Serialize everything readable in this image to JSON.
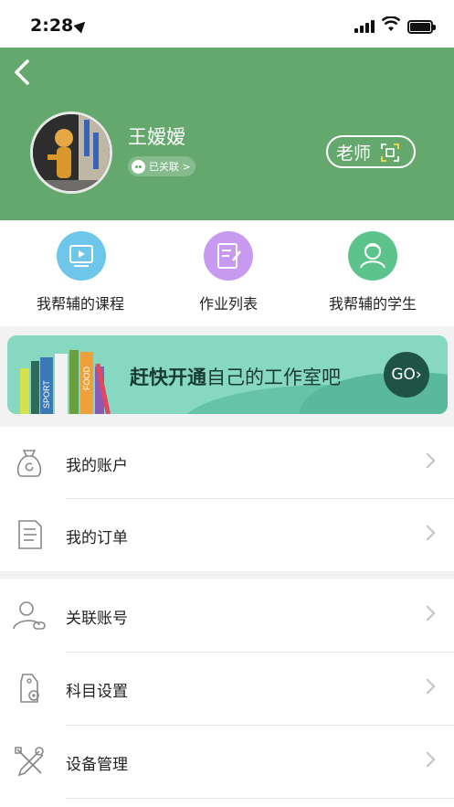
{
  "status_bar": {
    "time": "2:28"
  },
  "profile": {
    "name": "王嫒嫒",
    "wechat_badge": "已关联 >",
    "role": "老师"
  },
  "quick_actions": [
    {
      "label": "我帮辅的课程",
      "icon": "video-play-icon",
      "color": "#6ec6ea"
    },
    {
      "label": "作业列表",
      "icon": "edit-document-icon",
      "color": "#c79af0"
    },
    {
      "label": "我帮辅的学生",
      "icon": "student-icon",
      "color": "#5cc48b"
    }
  ],
  "banner": {
    "title_bold": "赶快开通",
    "title_rest": "自己的工作室吧",
    "go_label": "GO›",
    "book_labels": [
      "SPORT",
      "FOOD"
    ]
  },
  "menu_group1": [
    {
      "label": "我的账户",
      "icon": "money-bag-icon"
    },
    {
      "label": "我的订单",
      "icon": "order-list-icon"
    }
  ],
  "menu_group2": [
    {
      "label": "关联账号",
      "icon": "linked-user-icon"
    },
    {
      "label": "科目设置",
      "icon": "subject-settings-icon"
    },
    {
      "label": "设备管理",
      "icon": "tools-icon"
    }
  ],
  "colors": {
    "header_green": "#65a86e",
    "banner_mint": "#86d8c0",
    "go_button": "#1f5346"
  }
}
